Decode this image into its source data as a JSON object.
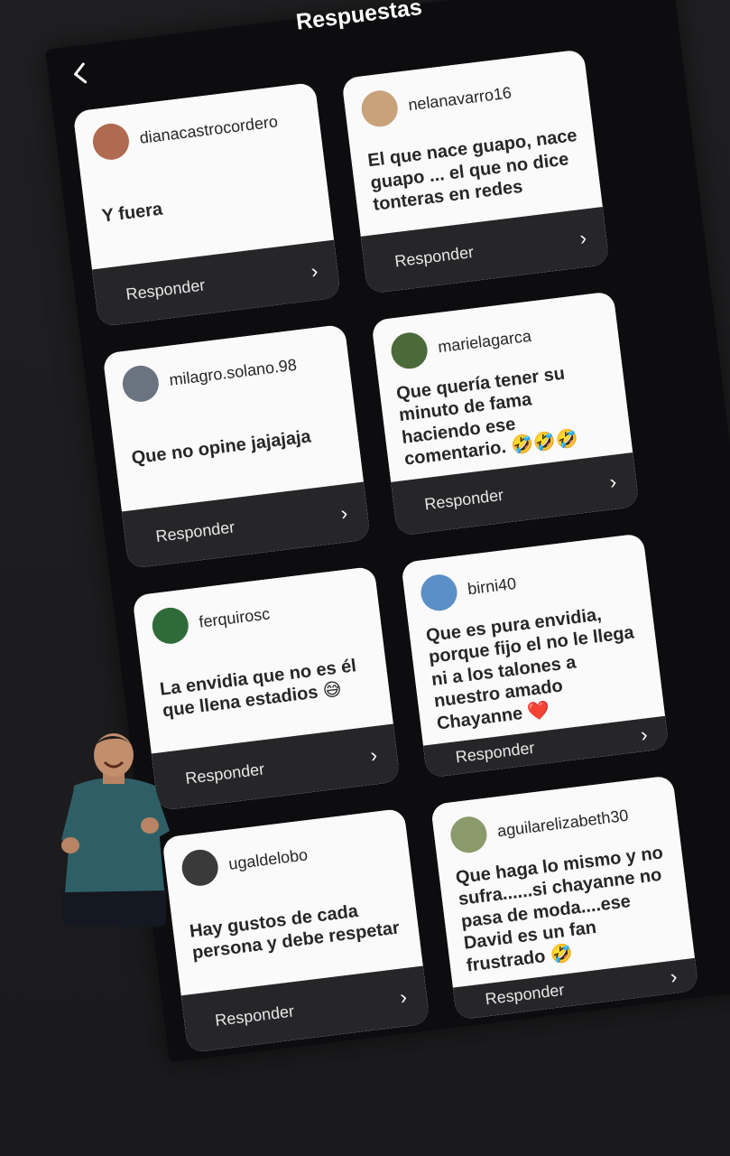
{
  "header": {
    "title": "Respuestas",
    "back_icon": "chevron-left-icon"
  },
  "cards": [
    {
      "username": "dianacastrocordero",
      "text": "Y fuera",
      "reply": "Responder",
      "avatar_color": "#b06a4f"
    },
    {
      "username": "nelanavarro16",
      "text": "El que nace guapo, nace guapo ... el que no dice tonteras en redes",
      "reply": "Responder",
      "avatar_color": "#c8a27a"
    },
    {
      "username": "milagro.solano.98",
      "text": "Que no opine jajajaja",
      "reply": "Responder",
      "avatar_color": "#6a7480"
    },
    {
      "username": "marielagarca",
      "text": "Que quería tener su minuto de fama haciendo ese comentario. 🤣🤣🤣",
      "reply": "Responder",
      "avatar_color": "#4b6a3a"
    },
    {
      "username": "ferquirosc",
      "text": "La envidia que no es él que llena estadios 😅",
      "reply": "Responder",
      "avatar_color": "#2f6b3a"
    },
    {
      "username": "birni40",
      "text": "Que es pura envidia, porque fijo el no le llega ni a los talones a nuestro amado Chayanne ❤️",
      "reply": "Responder",
      "avatar_color": "#5b8fc7"
    },
    {
      "username": "ugaldelobo",
      "text": "Hay gustos de cada persona y debe respetar",
      "reply": "Responder",
      "avatar_color": "#3a3a3a"
    },
    {
      "username": "aguilarelizabeth30",
      "text": "Que haga lo mismo y no sufra......si chayanne no pasa de moda....ese David es un fan frustrado 🤣",
      "reply": "Responder",
      "avatar_color": "#8a9a6a"
    }
  ],
  "sticker": {
    "name": "laughing-man-sticker",
    "shirt_color": "#2f5f66"
  }
}
